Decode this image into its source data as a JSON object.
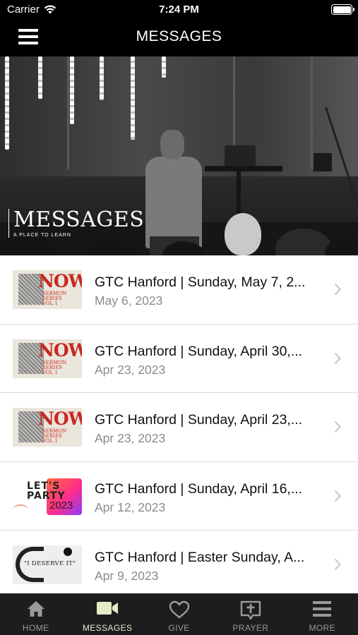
{
  "status_bar": {
    "carrier": "Carrier",
    "time": "7:24 PM"
  },
  "nav_bar": {
    "title": "MESSAGES"
  },
  "hero": {
    "brand_title": "MESSAGES",
    "brand_subtitle": "A PLACE TO LEARN"
  },
  "messages": [
    {
      "title": "GTC Hanford | Sunday, May 7, 2...",
      "date": "May 6, 2023",
      "thumb": "now"
    },
    {
      "title": "GTC Hanford | Sunday, April 30,...",
      "date": "Apr 23, 2023",
      "thumb": "now"
    },
    {
      "title": "GTC Hanford | Sunday, April 23,...",
      "date": "Apr 23, 2023",
      "thumb": "now"
    },
    {
      "title": "GTC Hanford | Sunday, April 16,...",
      "date": "Apr 12, 2023",
      "thumb": "party"
    },
    {
      "title": "GTC Hanford | Easter Sunday, A...",
      "date": "Apr 9, 2023",
      "thumb": "deserve"
    }
  ],
  "thumbs": {
    "now": {
      "word": "NOW",
      "sub_line1": "SERMON SERIES",
      "sub_line2": "VOL 1"
    },
    "party": {
      "line1": "LET'S",
      "line2": "PARTY",
      "year": "2023"
    },
    "deserve": {
      "quote": "\"I DESERVE IT\""
    }
  },
  "tabs": [
    {
      "label": "HOME",
      "icon": "home-icon"
    },
    {
      "label": "MESSAGES",
      "icon": "video-camera-icon",
      "active": true
    },
    {
      "label": "GIVE",
      "icon": "heart-icon"
    },
    {
      "label": "PRAYER",
      "icon": "prayer-icon"
    },
    {
      "label": "MORE",
      "icon": "more-menu-icon"
    }
  ],
  "colors": {
    "active_tab": "#e5ebc6",
    "inactive_tab": "#9a9a9a",
    "tab_bar_bg": "#1d1d1f",
    "now_red": "#c62a22"
  }
}
